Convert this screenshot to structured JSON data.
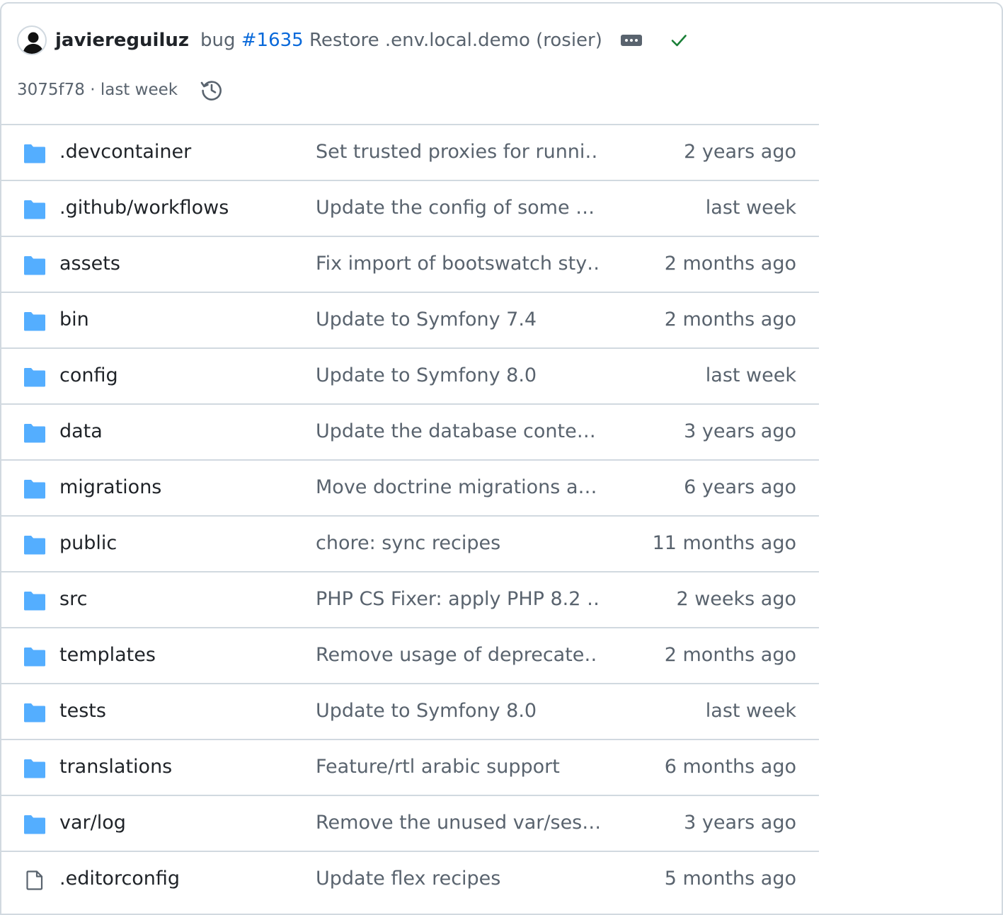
{
  "commit": {
    "author": "javiereguiluz",
    "message_prefix": "bug ",
    "message_link": "#1635",
    "message_rest": " Restore .env.local.demo (rosier)",
    "sha": "3075f78",
    "separator": " · ",
    "time": "last week",
    "status": "success"
  },
  "colors": {
    "folder": "#54aeff",
    "link": "#0969da",
    "success": "#1a7f37",
    "muted": "#59636e",
    "border": "#d1d9e0"
  },
  "files": [
    {
      "type": "folder",
      "icon": "folder-icon",
      "name": ".devcontainer",
      "message": "Set trusted proxies for runni…",
      "age": "2 years ago"
    },
    {
      "type": "folder",
      "icon": "folder-icon",
      "name": ".github/workflows",
      "message": "Update the config of some …",
      "age": "last week"
    },
    {
      "type": "folder",
      "icon": "folder-icon",
      "name": "assets",
      "message": "Fix import of bootswatch sty…",
      "age": "2 months ago"
    },
    {
      "type": "folder",
      "icon": "folder-icon",
      "name": "bin",
      "message": "Update to Symfony 7.4",
      "age": "2 months ago"
    },
    {
      "type": "folder",
      "icon": "folder-icon",
      "name": "config",
      "message": "Update to Symfony 8.0",
      "age": "last week"
    },
    {
      "type": "folder",
      "icon": "folder-icon",
      "name": "data",
      "message": "Update the database conte…",
      "age": "3 years ago"
    },
    {
      "type": "folder",
      "icon": "folder-icon",
      "name": "migrations",
      "message": "Move doctrine migrations a…",
      "age": "6 years ago"
    },
    {
      "type": "folder",
      "icon": "folder-icon",
      "name": "public",
      "message": "chore: sync recipes",
      "age": "11 months ago"
    },
    {
      "type": "folder",
      "icon": "folder-icon",
      "name": "src",
      "message": "PHP CS Fixer: apply PHP 8.2 …",
      "age": "2 weeks ago"
    },
    {
      "type": "folder",
      "icon": "folder-icon",
      "name": "templates",
      "message": "Remove usage of deprecate…",
      "age": "2 months ago"
    },
    {
      "type": "folder",
      "icon": "folder-icon",
      "name": "tests",
      "message": "Update to Symfony 8.0",
      "age": "last week"
    },
    {
      "type": "folder",
      "icon": "folder-icon",
      "name": "translations",
      "message": "Feature/rtl arabic support",
      "age": "6 months ago"
    },
    {
      "type": "folder",
      "icon": "folder-icon",
      "name": "var/log",
      "message": "Remove the unused var/ses…",
      "age": "3 years ago"
    },
    {
      "type": "file",
      "icon": "file-icon",
      "name": ".editorconfig",
      "message": "Update flex recipes",
      "age": "5 months ago"
    }
  ]
}
